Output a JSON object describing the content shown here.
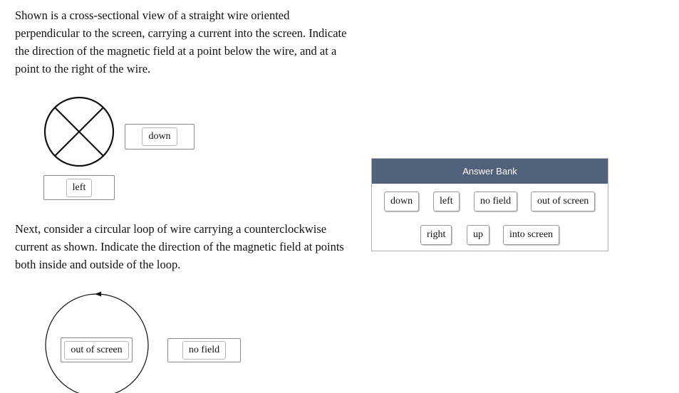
{
  "question1": {
    "text": "Shown is a cross-sectional view of a straight wire oriented perpendicular to the screen, carrying a current into the screen. Indicate the direction of the magnetic field at a point below the wire, and at a point to the right of the wire.",
    "right_zone_answer": "down",
    "below_zone_answer": "left"
  },
  "question2": {
    "text": "Next, consider a circular loop of wire carrying a counterclockwise current as shown. Indicate the direction of the magnetic field at points both inside and outside of the loop.",
    "inside_zone_answer": "out of screen",
    "outside_zone_answer": "no field"
  },
  "answer_bank": {
    "title": "Answer Bank",
    "items": [
      "down",
      "left",
      "no field",
      "out of screen",
      "right",
      "up",
      "into screen"
    ]
  },
  "colors": {
    "bank_header": "#506179",
    "stroke": "#111111"
  }
}
